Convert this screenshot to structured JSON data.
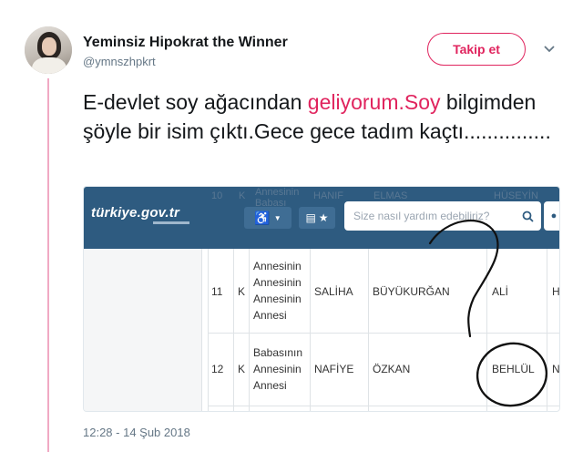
{
  "tweet": {
    "author_name": "Yeminsiz Hipokrat the Winner",
    "handle": "@ymnszhpkrt",
    "follow_label": "Takip et",
    "text_before": "E-devlet soy ağacından ",
    "text_link": "geliyorum.Soy",
    "text_after": " bilgimden şöyle bir isim çıktı.Gece gece tadım kaçtı...............",
    "timestamp": "12:28 - 14 Şub 2018"
  },
  "screenshot": {
    "logo": "türkiye.gov.tr",
    "search_placeholder": "Size nasıl yardım edebiliriz?",
    "ghost_row": [
      "10",
      "K",
      "Annesinin Babası",
      "HANIF",
      "ELMAS",
      "HÜSEYİN"
    ],
    "rows": [
      {
        "no": "11",
        "gender": "K",
        "relation": [
          "Annesinin",
          "Annesinin",
          "Annesinin",
          "Annesi"
        ],
        "first_name": "SALİHA",
        "last_name": "BÜYÜKURĞAN",
        "parent": "ALİ",
        "extra": "H"
      },
      {
        "no": "12",
        "gender": "K",
        "relation": [
          "Babasının",
          "Annesinin",
          "Annesi"
        ],
        "first_name": "NAFİYE",
        "last_name": "ÖZKAN",
        "parent": "BEHLÜL",
        "extra": "N"
      }
    ]
  },
  "colors": {
    "brand_pink": "#e0245e",
    "thread_line": "#f0a9c4",
    "gov_blue": "#2e5b80"
  },
  "icons": [
    "avatar",
    "chevron-down-icon",
    "accessibility-icon",
    "keyboard-icon",
    "star-icon",
    "search-icon",
    "user-icon",
    "question-mark-drawing",
    "circle-drawing"
  ]
}
